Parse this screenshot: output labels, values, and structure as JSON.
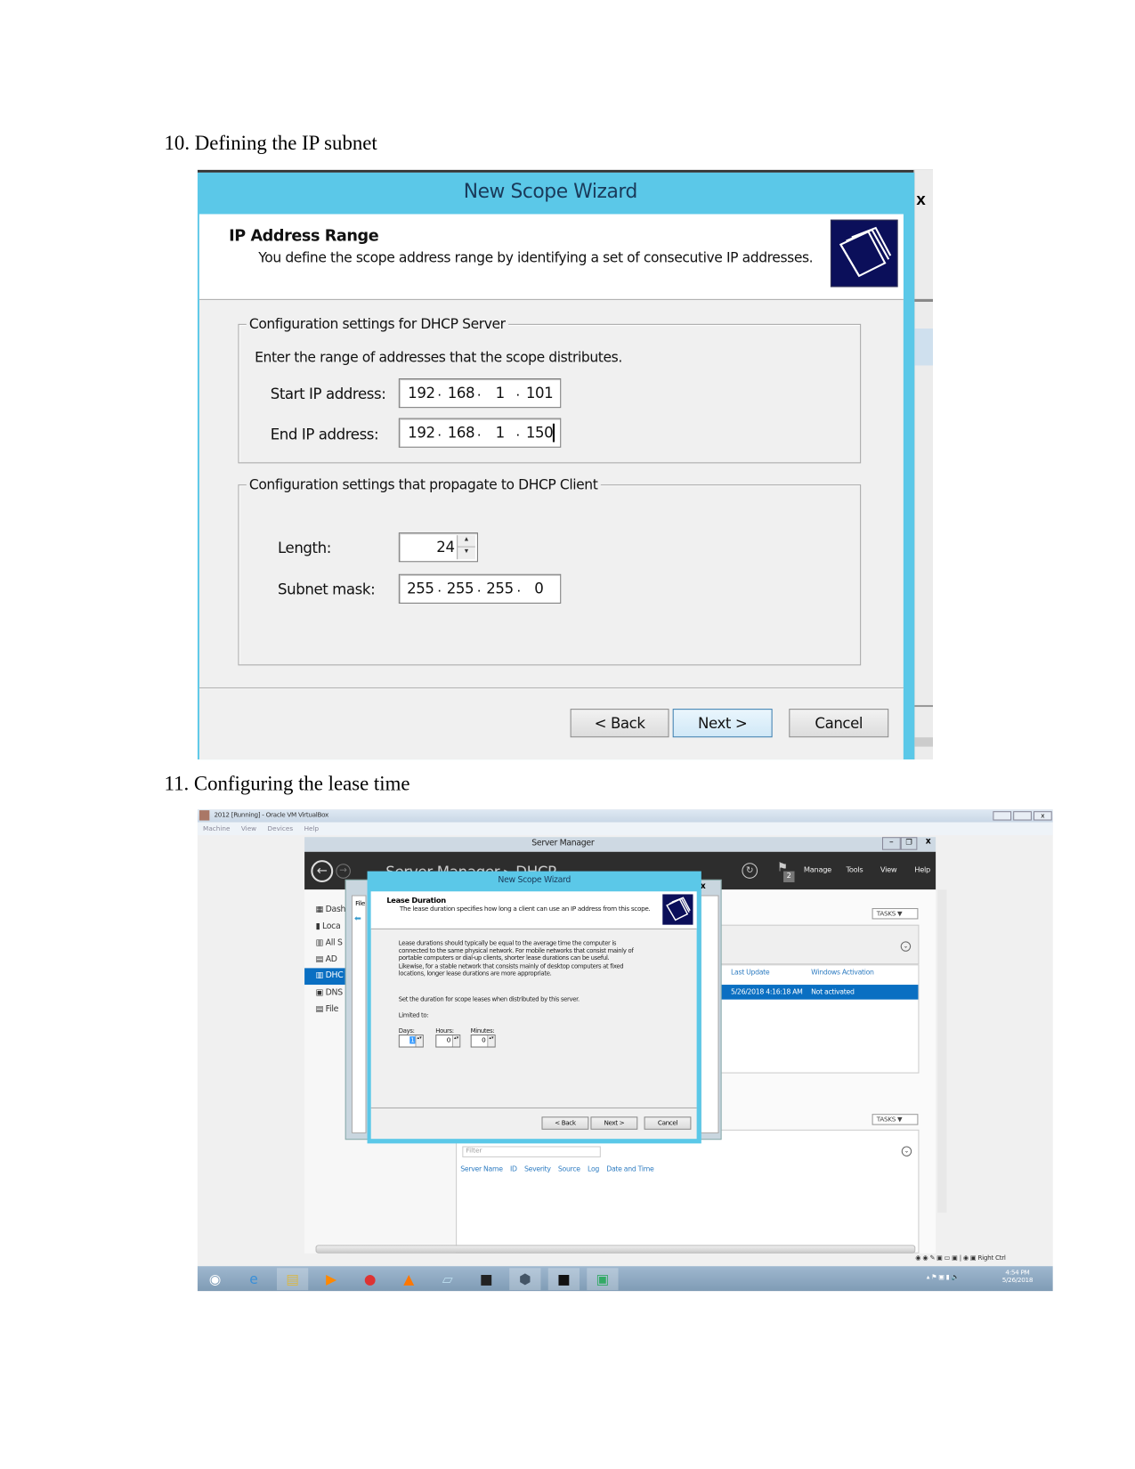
{
  "step10": {
    "heading": "10. Defining the IP subnet",
    "background_window_close": "x",
    "wizard": {
      "title": "New Scope Wizard",
      "section_title": "IP Address Range",
      "section_desc": "You define the scope address range by identifying a set of consecutive IP addresses.",
      "group1_legend": "Configuration settings for DHCP Server",
      "group1_intro": "Enter the range of addresses that the scope distributes.",
      "start_ip_label": "Start IP address:",
      "start_ip": [
        "192",
        "168",
        "1",
        "101"
      ],
      "end_ip_label": "End IP address:",
      "end_ip": [
        "192",
        "168",
        "1",
        "150"
      ],
      "group2_legend": "Configuration settings that propagate to DHCP Client",
      "length_label": "Length:",
      "length_value": "24",
      "subnet_label": "Subnet mask:",
      "subnet": [
        "255",
        "255",
        "255",
        "0"
      ],
      "back": "< Back",
      "next": "Next >",
      "cancel": "Cancel",
      "accent": "#5bc8e8"
    }
  },
  "step11": {
    "heading": "11. Configuring the lease time",
    "vbox": {
      "title": "2012 [Running] - Oracle VM VirtualBox",
      "menu": [
        "Machine",
        "View",
        "Devices",
        "Help"
      ],
      "host_key": "Right Ctrl"
    },
    "server_manager": {
      "title": "Server Manager",
      "breadcrumb": "Server Manager ▸ DHCP",
      "notification_count": "2",
      "menu": [
        "Manage",
        "Tools",
        "View",
        "Help"
      ],
      "sidebar": [
        "Dash",
        "Loca",
        "All S",
        "AD",
        "DHC",
        "DNS",
        "File"
      ],
      "tasks": "TASKS",
      "columns": [
        "Last Update",
        "Windows Activation"
      ],
      "row": [
        "5/26/2018 4:16:18 AM",
        "Not activated"
      ],
      "filter_placeholder": "Filter",
      "event_columns": [
        "Server Name",
        "ID",
        "Severity",
        "Source",
        "Log",
        "Date and Time"
      ],
      "mmc_file": "File",
      "selection_color": "#0a6fc2"
    },
    "wizard": {
      "title": "New Scope Wizard",
      "section_title": "Lease Duration",
      "section_desc": "The lease duration specifies how long a client can use an IP address from this scope.",
      "body": [
        "Lease durations should typically be equal to the average time the computer is",
        "connected to the same physical network. For mobile networks that consist mainly of",
        "portable computers or dial-up clients, shorter lease durations can be useful.",
        "Likewise, for a stable network that consists mainly of desktop computers at fixed",
        "locations, longer lease durations are more appropriate."
      ],
      "set_duration": "Set the duration for scope leases when distributed by this server.",
      "limited_to": "Limited to:",
      "days_label": "Days:",
      "days": "1",
      "hours_label": "Hours:",
      "hours": "0",
      "minutes_label": "Minutes:",
      "minutes": "0",
      "back": "< Back",
      "next": "Next >",
      "cancel": "Cancel"
    },
    "taskbar": {
      "time": "4:54 PM",
      "date": "5/26/2018",
      "icons": [
        "start-orb-icon",
        "ie-icon",
        "explorer-icon",
        "media-player-icon",
        "chrome-icon",
        "vlc-icon",
        "notepad-icon",
        "terminal-icon",
        "virtualbox-icon",
        "cmd-icon",
        "server-manager-icon"
      ]
    }
  }
}
